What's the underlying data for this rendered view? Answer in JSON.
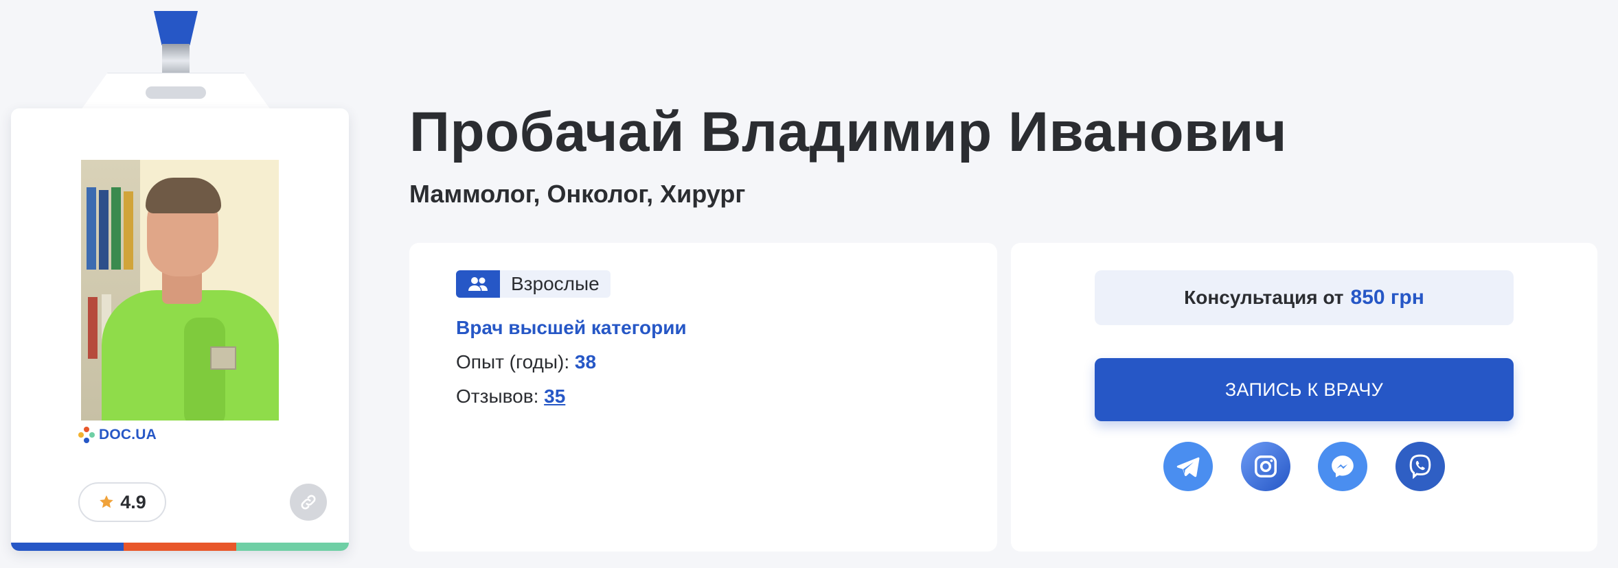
{
  "doctor": {
    "name": "Пробачай Владимир Иванович",
    "specialties": "Маммолог, Онколог, Хирург"
  },
  "badge": {
    "logo_text": "DOC.UA",
    "rating": "4.9",
    "strip_colors": [
      "#2657c6",
      "#e8572a",
      "#6fcfa5"
    ]
  },
  "info": {
    "patient_group": "Взрослые",
    "category": "Врач высшей категории",
    "experience_label": "Опыт (годы):",
    "experience_value": "38",
    "reviews_label": "Отзывов:",
    "reviews_value": "35"
  },
  "booking": {
    "price_label": "Консультация от",
    "price_value": "850 грн",
    "book_button": "ЗАПИСЬ К ВРАЧУ",
    "socials": [
      "telegram-icon",
      "instagram-icon",
      "messenger-icon",
      "viber-icon"
    ]
  },
  "colors": {
    "accent": "#2657c6",
    "text": "#2b2d31",
    "background": "#f5f6f9",
    "chip_bg": "#edf1fa"
  }
}
